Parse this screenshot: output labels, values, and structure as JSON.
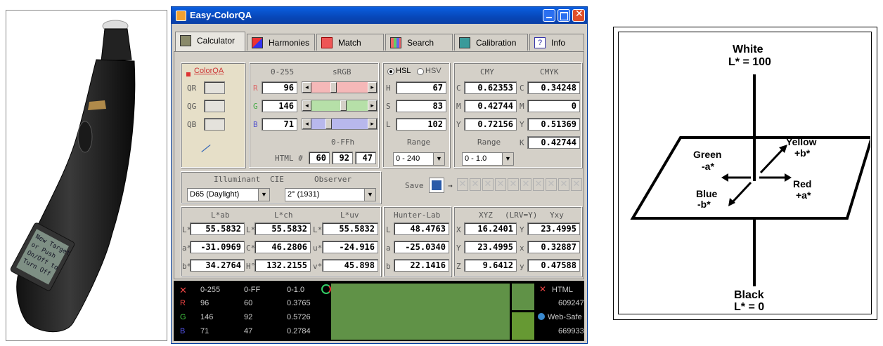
{
  "window": {
    "title": "Easy-ColorQA"
  },
  "tabs": [
    {
      "label": "Calculator"
    },
    {
      "label": "Harmonies"
    },
    {
      "label": "Match"
    },
    {
      "label": "Search"
    },
    {
      "label": "Calibration"
    },
    {
      "label": "Info"
    }
  ],
  "colorqa": {
    "title": "ColorQA",
    "labels": [
      "QR",
      "QG",
      "QB"
    ]
  },
  "srgb": {
    "range_label": "0-255",
    "space_label": "sRGB",
    "channels": [
      {
        "label": "R",
        "value": "96",
        "fraction": 0.376
      },
      {
        "label": "G",
        "value": "146",
        "fraction": 0.573
      },
      {
        "label": "B",
        "value": "71",
        "fraction": 0.278
      }
    ],
    "hex_range_label": "0-FFh",
    "html_label": "HTML #",
    "hex": [
      "60",
      "92",
      "47"
    ]
  },
  "hsl": {
    "opt_hsl": "HSL",
    "opt_hsv": "HSV",
    "rows": [
      {
        "label": "H",
        "value": "67"
      },
      {
        "label": "S",
        "value": "83"
      },
      {
        "label": "L",
        "value": "102"
      }
    ],
    "range_label": "Range",
    "range_value": "0 - 240"
  },
  "cmy": {
    "title": "CMY",
    "rows": [
      {
        "label": "C",
        "value": "0.62353"
      },
      {
        "label": "M",
        "value": "0.42744"
      },
      {
        "label": "Y",
        "value": "0.72156"
      }
    ],
    "range_label": "Range",
    "range_value": "0 - 1.0"
  },
  "cmyk": {
    "title": "CMYK",
    "rows": [
      {
        "label": "C",
        "value": "0.34248"
      },
      {
        "label": "M",
        "value": "0"
      },
      {
        "label": "Y",
        "value": "0.51369"
      },
      {
        "label": "K",
        "value": "0.42744"
      }
    ]
  },
  "cie": {
    "illuminant_label": "Illuminant",
    "cie_label": "CIE",
    "observer_label": "Observer",
    "illuminant_value": "D65 (Daylight)",
    "observer_value": "2° (1931)",
    "save_label": "Save",
    "lab_title": "L*ab",
    "lch_title": "L*ch",
    "luv_title": "L*uv",
    "lab": [
      {
        "label": "L*",
        "value": "55.5832"
      },
      {
        "label": "a*",
        "value": "-31.0969"
      },
      {
        "label": "b*",
        "value": "34.2764"
      }
    ],
    "lch": [
      {
        "label": "L*",
        "value": "55.5832"
      },
      {
        "label": "C*",
        "value": "46.2806"
      },
      {
        "label": "H°",
        "value": "132.2155"
      }
    ],
    "luv": [
      {
        "label": "L*",
        "value": "55.5832"
      },
      {
        "label": "u*",
        "value": "-24.916"
      },
      {
        "label": "v*",
        "value": "45.898"
      }
    ]
  },
  "hunter": {
    "title": "Hunter-Lab",
    "rows": [
      {
        "label": "L",
        "value": "48.4763"
      },
      {
        "label": "a",
        "value": "-25.0340"
      },
      {
        "label": "b",
        "value": "22.1416"
      }
    ]
  },
  "xyz": {
    "title": "XYZ",
    "lrv_label": "(LRV=Y)",
    "yxy_title": "Yxy",
    "xyz": [
      {
        "label": "X",
        "value": "16.2401"
      },
      {
        "label": "Y",
        "value": "23.4995"
      },
      {
        "label": "Z",
        "value": "9.6412"
      }
    ],
    "yxy": [
      {
        "label": "Y",
        "value": "23.4995"
      },
      {
        "label": "x",
        "value": "0.32887"
      },
      {
        "label": "y",
        "value": "0.47588"
      }
    ]
  },
  "bottom": {
    "headers": [
      "0-255",
      "0-FF",
      "0-1.0"
    ],
    "rows": [
      {
        "label": "R",
        "v255": "96",
        "vhex": "60",
        "v1": "0.3765"
      },
      {
        "label": "G",
        "v255": "146",
        "vhex": "92",
        "v1": "0.5726"
      },
      {
        "label": "B",
        "v255": "71",
        "vhex": "47",
        "v1": "0.2784"
      }
    ],
    "html_label": "HTML",
    "html_value": "609247",
    "websafe_label": "Web-Safe",
    "websafe_value": "669933",
    "swatch_color": "#609247",
    "websafe_color": "#669933"
  },
  "device": {
    "screen_text": [
      "New Target",
      "or Push",
      "On/Off to",
      "Turn Off"
    ]
  },
  "diagram": {
    "white": "White",
    "white_l": "L* = 100",
    "black": "Black",
    "black_l": "L* = 0",
    "yellow": "Yellow",
    "yellow_b": "+b*",
    "green": "Green",
    "green_a": "-a*",
    "red": "Red",
    "red_a": "+a*",
    "blue": "Blue",
    "blue_b": "-b*"
  }
}
